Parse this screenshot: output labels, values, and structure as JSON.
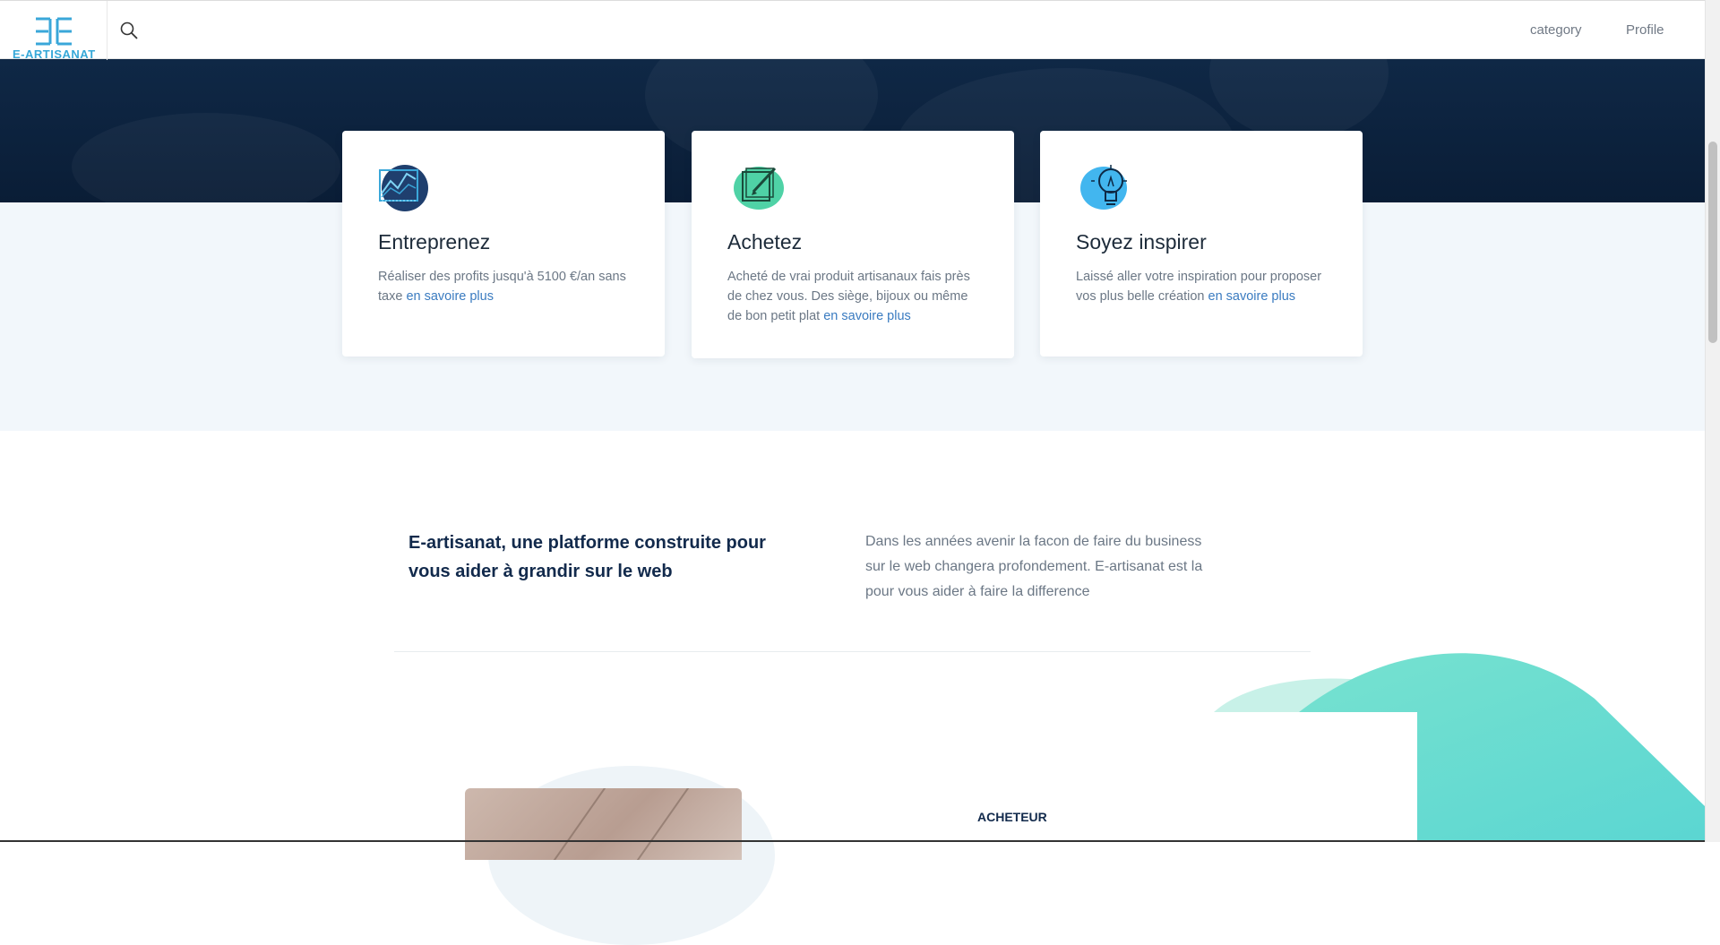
{
  "header": {
    "logo_text": "E-ARTISANAT",
    "nav": {
      "category": "category",
      "profile": "Profile"
    }
  },
  "cards": [
    {
      "title": "Entreprenez",
      "text": "Réaliser des profits jusqu'à 5100 €/an sans taxe ",
      "link": "en savoire plus",
      "icon": "chart-icon"
    },
    {
      "title": "Achetez",
      "text": "Acheté de vrai produit artisanaux fais près de chez vous. Des siège, bijoux ou même de bon petit plat ",
      "link": "en savoire plus",
      "icon": "notepad-pencil-icon"
    },
    {
      "title": "Soyez inspirer",
      "text": "Laissé aller votre inspiration pour proposer vos plus belle création ",
      "link": "en savoire plus",
      "icon": "lightbulb-icon"
    }
  ],
  "intro": {
    "title": "E-artisanat, une platforme construite pour vous aider à grandir sur le web",
    "text": "Dans les années avenir la facon de faire du business sur le web changera profondement. E-artisanat est la pour vous aider à faire la difference"
  },
  "section2": {
    "label": "ACHETEUR"
  },
  "colors": {
    "navy": "#122a4c",
    "hero": "#0f2846",
    "teal": "#5fd9c9",
    "link": "#3a7bc0"
  }
}
